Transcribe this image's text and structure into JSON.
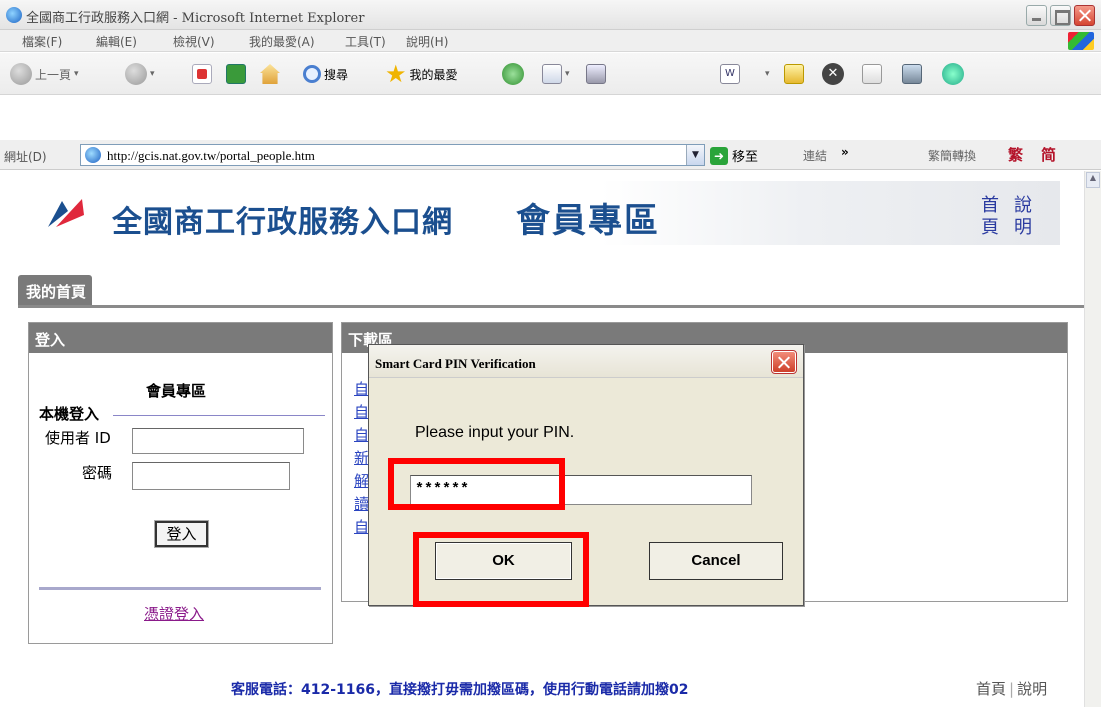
{
  "window": {
    "title": "全國商工行政服務入口網 - Microsoft Internet Explorer"
  },
  "menu": [
    "檔案(F)",
    "編輯(E)",
    "檢視(V)",
    "我的最愛(A)",
    "工具(T)",
    "說明(H)"
  ],
  "toolbar": {
    "back_label": "上一頁",
    "search_label": "搜尋",
    "favorites_label": "我的最愛"
  },
  "address": {
    "label": "網址(D)",
    "url": "http://gcis.nat.gov.tw/portal_people.htm",
    "go_label": "移至",
    "links_label": "連結",
    "more_label": "»",
    "convert_label": "繁簡轉換",
    "traditional": "繁",
    "simplified": "简"
  },
  "header": {
    "site_title": "全國商工行政服務入口網",
    "zone_title": "會員專區",
    "home_link": [
      "首",
      "頁"
    ],
    "help_link": [
      "說",
      "明"
    ]
  },
  "tab": {
    "label": "我的首頁"
  },
  "login": {
    "heading": "登入",
    "zone": "會員專區",
    "local_login": "本機登入",
    "user_id_label": "使用者 ID",
    "password_label": "密碼",
    "login_button": "登入",
    "cert_login": "憑證登入"
  },
  "downloads": {
    "heading": "下載區",
    "items": [
      "自",
      "自",
      "自",
      "新",
      "解",
      "讀",
      "自"
    ]
  },
  "dialog": {
    "title": "Smart Card PIN Verification",
    "prompt": "Please input your PIN.",
    "pin_value": "******",
    "ok_label": "OK",
    "cancel_label": "Cancel"
  },
  "footer": {
    "phone_text": "客服電話：412-1166，直接撥打毋需加撥區碼，使用行動電話請加撥02",
    "home": "首頁",
    "help": "說明"
  },
  "colors": {
    "brand_blue": "#1b4f8f",
    "panel_gray": "#7a7a7a",
    "highlight_red": "#ff0000",
    "dialog_bg": "#ece9d8"
  }
}
